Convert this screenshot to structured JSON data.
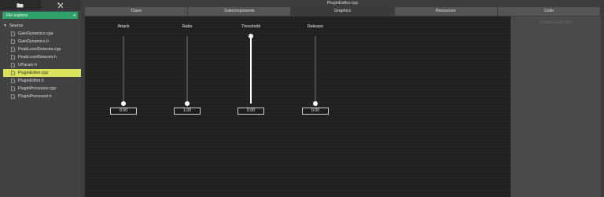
{
  "sidebar": {
    "tabs": [
      {
        "icon": "folder-icon",
        "active": true
      },
      {
        "icon": "tools-icon",
        "active": false
      }
    ],
    "explorer_label": "File explorer",
    "group": "Source",
    "files": [
      "GainDynamics.cpp",
      "GainDynamics.h",
      "PeakLevelDetector.cpp",
      "PeakLevelDetector.h",
      "UParam.h",
      "PluginEditor.cpp",
      "PluginEditor.h",
      "PluginProcessor.cpp",
      "PluginProcessor.h"
    ],
    "selected_file": "PluginEditor.cpp"
  },
  "header": {
    "title": "PluginEditor.cpp"
  },
  "tabs": [
    "Class",
    "Subcomponents",
    "Graphics",
    "Resources",
    "Code"
  ],
  "active_tab": "Graphics",
  "right_panel": {
    "label": "(nothing selected)"
  },
  "sliders": [
    {
      "label": "Attack",
      "value": "0.00",
      "level": 0.0
    },
    {
      "label": "Ratio",
      "value": "1.00",
      "level": 0.0
    },
    {
      "label": "Threshold",
      "value": "0.00",
      "level": 1.0
    },
    {
      "label": "Release",
      "value": "0.00",
      "level": 0.0
    }
  ],
  "colors": {
    "accent_green": "#2fa36a",
    "selection_yellow": "#d9e35c",
    "canvas": "#202020"
  }
}
